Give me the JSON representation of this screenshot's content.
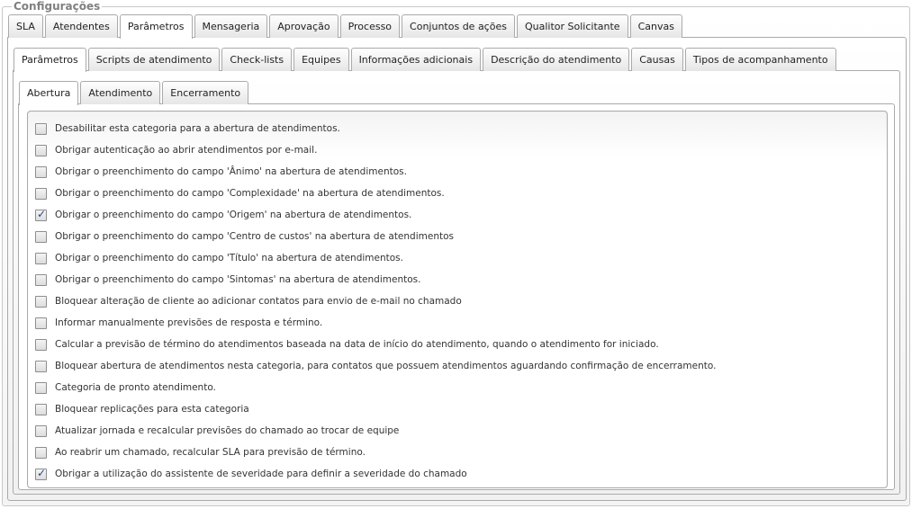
{
  "fieldset": {
    "legend": "Configurações"
  },
  "main_tabs": [
    {
      "label": "SLA",
      "active": false
    },
    {
      "label": "Atendentes",
      "active": false
    },
    {
      "label": "Parâmetros",
      "active": true
    },
    {
      "label": "Mensageria",
      "active": false
    },
    {
      "label": "Aprovação",
      "active": false
    },
    {
      "label": "Processo",
      "active": false
    },
    {
      "label": "Conjuntos de ações",
      "active": false
    },
    {
      "label": "Qualitor Solicitante",
      "active": false
    },
    {
      "label": "Canvas",
      "active": false
    }
  ],
  "sub_tabs": [
    {
      "label": "Parâmetros",
      "active": true
    },
    {
      "label": "Scripts de atendimento",
      "active": false
    },
    {
      "label": "Check-lists",
      "active": false
    },
    {
      "label": "Equipes",
      "active": false
    },
    {
      "label": "Informações adicionais",
      "active": false
    },
    {
      "label": "Descrição do atendimento",
      "active": false
    },
    {
      "label": "Causas",
      "active": false
    },
    {
      "label": "Tipos de acompanhamento",
      "active": false
    }
  ],
  "inner_tabs": [
    {
      "label": "Abertura",
      "active": true
    },
    {
      "label": "Atendimento",
      "active": false
    },
    {
      "label": "Encerramento",
      "active": false
    }
  ],
  "options": [
    {
      "label": "Desabilitar esta categoria para a abertura de atendimentos.",
      "checked": false
    },
    {
      "label": "Obrigar autenticação ao abrir atendimentos por e-mail.",
      "checked": false
    },
    {
      "label": "Obrigar o preenchimento do campo 'Ânimo' na abertura de atendimentos.",
      "checked": false
    },
    {
      "label": "Obrigar o preenchimento do campo 'Complexidade' na abertura de atendimentos.",
      "checked": false
    },
    {
      "label": "Obrigar o preenchimento do campo 'Origem' na abertura de atendimentos.",
      "checked": true
    },
    {
      "label": "Obrigar o preenchimento do campo 'Centro de custos' na abertura de atendimentos",
      "checked": false
    },
    {
      "label": "Obrigar o preenchimento do campo 'Título' na abertura de atendimentos.",
      "checked": false
    },
    {
      "label": "Obrigar o preenchimento do campo 'Sintomas' na abertura de atendimentos.",
      "checked": false
    },
    {
      "label": "Bloquear alteração de cliente ao adicionar contatos para envio de e-mail no chamado",
      "checked": false
    },
    {
      "label": "Informar manualmente previsões de resposta e término.",
      "checked": false
    },
    {
      "label": "Calcular a previsão de término do atendimentos baseada na data de início do atendimento, quando o atendimento for iniciado.",
      "checked": false
    },
    {
      "label": "Bloquear abertura de atendimentos nesta categoria, para contatos que possuem atendimentos aguardando confirmação de encerramento.",
      "checked": false
    },
    {
      "label": "Categoria de pronto atendimento.",
      "checked": false
    },
    {
      "label": "Bloquear replicações para esta categoria",
      "checked": false
    },
    {
      "label": "Atualizar jornada e recalcular previsões do chamado ao trocar de equipe",
      "checked": false
    },
    {
      "label": "Ao reabrir um chamado, recalcular SLA para previsão de término.",
      "checked": false
    },
    {
      "label": "Obrigar a utilização do assistente de severidade para definir a severidade do chamado",
      "checked": true
    }
  ]
}
